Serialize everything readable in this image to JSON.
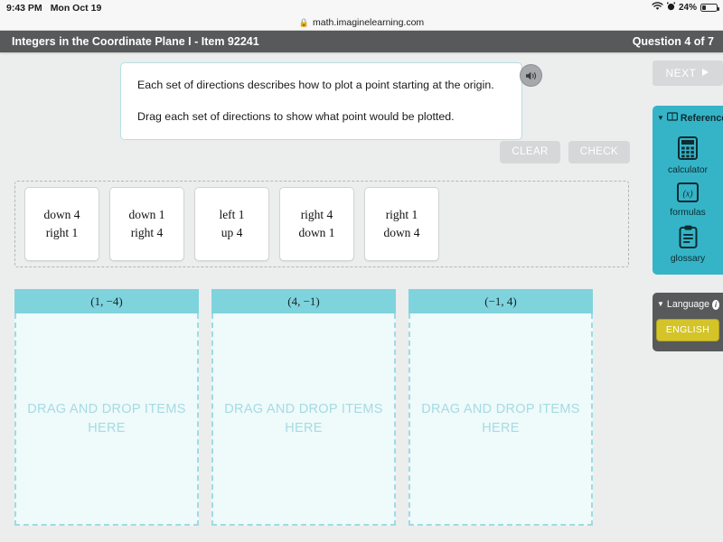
{
  "status_bar": {
    "time": "9:43 PM",
    "date": "Mon Oct 19",
    "wifi_icon": "wifi-icon",
    "alarm_icon": "alarm-clock-icon",
    "battery_percent": "24%",
    "battery_icon": "battery-icon"
  },
  "browser": {
    "lock_icon": "lock-icon",
    "url": "math.imaginelearning.com"
  },
  "title_bar": {
    "title": "Integers in the Coordinate Plane I - Item 92241",
    "question_counter": "Question 4 of 7"
  },
  "prompt": {
    "line1": "Each set of directions describes how to plot a point starting at the origin.",
    "line2": "Drag each set of directions to show what point would be plotted.",
    "speaker_icon": "speaker-icon"
  },
  "actions": {
    "clear_label": "CLEAR",
    "check_label": "CHECK"
  },
  "tray": {
    "cards": [
      {
        "line1": "down 4",
        "line2": "right 1"
      },
      {
        "line1": "down 1",
        "line2": "right 4"
      },
      {
        "line1": "left 1",
        "line2": "up 4"
      },
      {
        "line1": "right 4",
        "line2": "down 1"
      },
      {
        "line1": "right 1",
        "line2": "down 4"
      }
    ]
  },
  "drop_zones": {
    "placeholder": "DRAG AND DROP ITEMS HERE",
    "zones": [
      {
        "label": "(1, −4)"
      },
      {
        "label": "(4, −1)"
      },
      {
        "label": "(−1, 4)"
      }
    ]
  },
  "rail": {
    "next_label": "NEXT",
    "next_icon": "play-triangle-icon",
    "reference": {
      "title": "Reference",
      "caret_icon": "caret-down-icon",
      "book_icon": "book-icon",
      "items": [
        {
          "label": "calculator",
          "icon": "calculator-icon"
        },
        {
          "label": "formulas",
          "icon": "formulas-icon"
        },
        {
          "label": "glossary",
          "icon": "clipboard-icon"
        }
      ]
    },
    "language": {
      "title": "Language",
      "caret_icon": "caret-down-icon",
      "info_icon": "info-icon",
      "current": "ENGLISH"
    }
  },
  "colors": {
    "header_gray": "#58595b",
    "teal": "#35b4c7",
    "zone_header": "#7fd3dd",
    "zone_body": "#effafb",
    "english_yellow": "#d4c42a",
    "disabled_gray": "#d6d7d8"
  }
}
